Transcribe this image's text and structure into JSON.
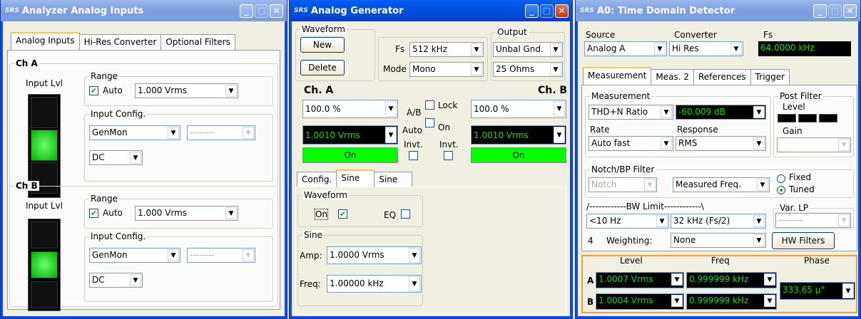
{
  "win1": {
    "logo": "SRS",
    "title": "Analyzer Analog Inputs",
    "tabs": [
      "Analog Inputs",
      "Hi-Res Converter",
      "Optional Filters"
    ],
    "cha": {
      "title": "Ch A",
      "input_lvl": "Input Lvl",
      "range": "Range",
      "auto": "Auto",
      "range_val": "1.000 Vrms",
      "input_config": "Input Config.",
      "config_val": "GenMon",
      "config2_val": "--------",
      "coupling_val": "DC",
      "led_level": "1 of 3"
    },
    "chb": {
      "title": "Ch B",
      "input_lvl": "Input Lvl",
      "range": "Range",
      "auto": "Auto",
      "range_val": "1.000 Vrms",
      "input_config": "Input Config.",
      "config_val": "GenMon",
      "config2_val": "--------",
      "coupling_val": "DC",
      "led_level": "1 of 3"
    }
  },
  "win2": {
    "logo": "SRS",
    "title": "Analog Generator",
    "waveform": "Waveform",
    "new_btn": "New",
    "delete_btn": "Delete",
    "fs_label": "Fs",
    "fs_val": "512 kHz",
    "mode_label": "Mode",
    "mode_val": "Mono",
    "output": "Output",
    "out1_val": "Unbal Gnd.",
    "out2_val": "25 Ohms",
    "cha": "Ch. A",
    "chb": "Ch. B",
    "cha_pct": "100.0 %",
    "chb_pct": "100.0 %",
    "cha_v": "1.0010 Vrms",
    "chb_v": "1.0010 Vrms",
    "ab": "A/B",
    "lock": "Lock",
    "auto": "Auto",
    "on_lbl": "On",
    "invt": "Invt.",
    "on_btn": "On",
    "tabs": [
      "Config.",
      "Sine",
      "Sine"
    ],
    "wf_group": "Waveform",
    "wf_on": "On",
    "eq": "EQ",
    "sine_group": "Sine",
    "amp_label": "Amp:",
    "amp_val": "1.0000 Vrms",
    "freq_label": "Freq:",
    "freq_val": "1.00000 kHz"
  },
  "win3": {
    "logo": "SRS",
    "title": "A0: Time Domain Detector",
    "source": "Source",
    "source_val": "Analog A",
    "converter": "Converter",
    "converter_val": "Hi Res",
    "fs": "Fs",
    "fs_val": "64.0000 kHz",
    "tabs": [
      "Measurement",
      "Meas. 2",
      "References",
      "Trigger"
    ],
    "measurement": "Measurement",
    "meas_val": "THD+N Ratio",
    "meas_reading": "-60.009 dB",
    "rate": "Rate",
    "rate_val": "Auto fast",
    "response": "Response",
    "response_val": "RMS",
    "post_filter": "Post Filter",
    "level": "Level",
    "gain": "Gain",
    "notch_group": "Notch/BP Filter",
    "notch_val": "Notch",
    "measured_freq": "Measured Freq.",
    "fixed": "Fixed",
    "tuned": "Tuned",
    "bw_limit": "/------------BW Limit------------\\",
    "bw_low": "<10 Hz",
    "bw_high": "32 kHz (Fs/2)",
    "var_lp": "Var. LP",
    "var_lp_val": "--------",
    "four": "4",
    "weighting": "Weighting:",
    "weighting_val": "None",
    "hw_filters": "HW Filters",
    "col_level": "Level",
    "col_freq": "Freq",
    "col_phase": "Phase",
    "row_a": "A",
    "row_b": "B",
    "a_level": "1.0007 Vrms",
    "a_freq": "0.999999 kHz",
    "b_level": "1.0004 Vrms",
    "b_freq": "0.999999 kHz",
    "phase": "333.65 µ°"
  }
}
